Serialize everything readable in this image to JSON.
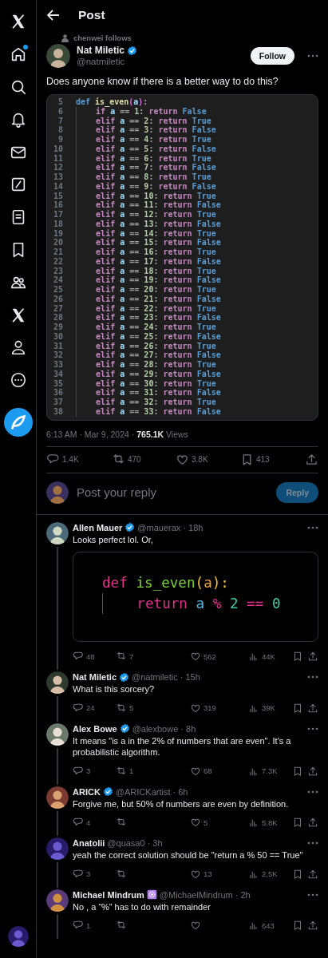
{
  "sidebar": {
    "items": [
      {
        "kind": "logo",
        "unread": false
      },
      {
        "kind": "home",
        "unread": true
      },
      {
        "kind": "search",
        "unread": false
      },
      {
        "kind": "notifications",
        "unread": false
      },
      {
        "kind": "messages",
        "unread": false
      },
      {
        "kind": "grok",
        "unread": false
      },
      {
        "kind": "lists",
        "unread": false
      },
      {
        "kind": "bookmarks",
        "unread": false
      },
      {
        "kind": "communities",
        "unread": false
      },
      {
        "kind": "premium",
        "unread": false
      },
      {
        "kind": "profile",
        "unread": false
      },
      {
        "kind": "more",
        "unread": false
      },
      {
        "kind": "compose",
        "unread": false
      }
    ]
  },
  "header": {
    "title": "Post"
  },
  "post": {
    "social_context": "chenwei follows",
    "author": "Nat Miletic",
    "verified": true,
    "handle": "@natmiletic",
    "follow_button": "Follow",
    "text": "Does anyone know if there is a better way to do this?",
    "code_image": {
      "lines": [
        {
          "number": "5",
          "code": "def is_even(a):"
        },
        {
          "number": "6",
          "code": "    if a == 1: return False"
        },
        {
          "number": "7",
          "code": "    elif a == 2: return True"
        },
        {
          "number": "8",
          "code": "    elif a == 3: return False"
        },
        {
          "number": "9",
          "code": "    elif a == 4: return True"
        },
        {
          "number": "10",
          "code": "    elif a == 5: return False"
        },
        {
          "number": "11",
          "code": "    elif a == 6: return True"
        },
        {
          "number": "12",
          "code": "    elif a == 7: return False"
        },
        {
          "number": "13",
          "code": "    elif a == 8: return True"
        },
        {
          "number": "14",
          "code": "    elif a == 9: return False"
        },
        {
          "number": "15",
          "code": "    elif a == 10: return True"
        },
        {
          "number": "16",
          "code": "    elif a == 11: return False"
        },
        {
          "number": "17",
          "code": "    elif a == 12: return True"
        },
        {
          "number": "18",
          "code": "    elif a == 13: return False"
        },
        {
          "number": "19",
          "code": "    elif a == 14: return True"
        },
        {
          "number": "20",
          "code": "    elif a == 15: return False"
        },
        {
          "number": "21",
          "code": "    elif a == 16: return True"
        },
        {
          "number": "22",
          "code": "    elif a == 17: return False"
        },
        {
          "number": "23",
          "code": "    elif a == 18: return True"
        },
        {
          "number": "24",
          "code": "    elif a == 19: return False"
        },
        {
          "number": "25",
          "code": "    elif a == 20: return True"
        },
        {
          "number": "26",
          "code": "    elif a == 21: return False"
        },
        {
          "number": "27",
          "code": "    elif a == 22: return True"
        },
        {
          "number": "28",
          "code": "    elif a == 23: return False"
        },
        {
          "number": "29",
          "code": "    elif a == 24: return True"
        },
        {
          "number": "30",
          "code": "    elif a == 25: return False"
        },
        {
          "number": "31",
          "code": "    elif a == 26: return True"
        },
        {
          "number": "32",
          "code": "    elif a == 27: return False"
        },
        {
          "number": "33",
          "code": "    elif a == 28: return True"
        },
        {
          "number": "34",
          "code": "    elif a == 29: return False"
        },
        {
          "number": "35",
          "code": "    elif a == 30: return True"
        },
        {
          "number": "36",
          "code": "    elif a == 31: return False"
        },
        {
          "number": "37",
          "code": "    elif a == 32: return True"
        },
        {
          "number": "38",
          "code": "    elif a == 33: return False"
        }
      ]
    },
    "timestamp": "6:13 AM · Mar 9, 2024 · ",
    "views": "765.1K",
    "views_label": "Views",
    "actions": {
      "replies": "1.4K",
      "reposts": "470",
      "likes": "3.8K",
      "bookmarks": "413"
    }
  },
  "composer": {
    "placeholder": "Post your reply",
    "button": "Reply",
    "disabled": true
  },
  "replies": [
    {
      "author": "Allen Mauer",
      "verified": true,
      "affiliate": false,
      "meta": "@mauerax · 18h",
      "text": "Looks perfect lol. Or,",
      "code_image": {
        "lines": [
          [
            {
              "text": "def ",
              "color": "#e3318c"
            },
            {
              "text": "is_even",
              "color": "#7fd13b"
            },
            {
              "text": "(",
              "color": "#f2c12e"
            },
            {
              "text": "a",
              "color": "#f0a03c"
            },
            {
              "text": "):",
              "color": "#f2c12e"
            }
          ],
          [
            {
              "text": "    return ",
              "color": "#e3318c"
            },
            {
              "text": "a ",
              "color": "#4fb8e6"
            },
            {
              "text": "% ",
              "color": "#e3318c"
            },
            {
              "text": "2 ",
              "color": "#3ccfa7"
            },
            {
              "text": "== ",
              "color": "#e3318c"
            },
            {
              "text": "0",
              "color": "#3ccfa7"
            }
          ]
        ]
      },
      "actions": {
        "replies": "48",
        "reposts": "7",
        "likes": "562",
        "views": "44K"
      }
    },
    {
      "author": "Nat Miletic",
      "verified": true,
      "affiliate": false,
      "meta": "@natmiletic · 15h",
      "text": "What is this sorcery?",
      "actions": {
        "replies": "24",
        "reposts": "5",
        "likes": "319",
        "views": "39K"
      }
    },
    {
      "author": "Alex Bowe",
      "verified": true,
      "affiliate": false,
      "meta": "@alexbowe · 8h",
      "text": "It means \"is a in the 2% of numbers that are even\". It's a probabilistic algorithm.",
      "actions": {
        "replies": "3",
        "reposts": "1",
        "likes": "68",
        "views": "7.3K"
      }
    },
    {
      "author": "ARICK",
      "verified": true,
      "affiliate": false,
      "meta": "@ARICKartist · 6h",
      "text": "Forgive me, but 50% of numbers are even by definition.",
      "actions": {
        "replies": "4",
        "likes": "5",
        "views": "5.8K"
      }
    },
    {
      "author": "Anatolii",
      "verified": false,
      "affiliate": false,
      "meta": "@quasa0 · 3h",
      "text": "yeah the correct solution should be \"return a % 50 == True\"",
      "actions": {
        "replies": "3",
        "likes": "13",
        "views": "2.5K"
      }
    },
    {
      "author": "Michael Mindrum",
      "verified": false,
      "affiliate": true,
      "meta": "@MichaelMindrum · 2h",
      "text": "No , a “%” has to do with remainder",
      "actions": {
        "replies": "1",
        "views": "643"
      }
    }
  ]
}
